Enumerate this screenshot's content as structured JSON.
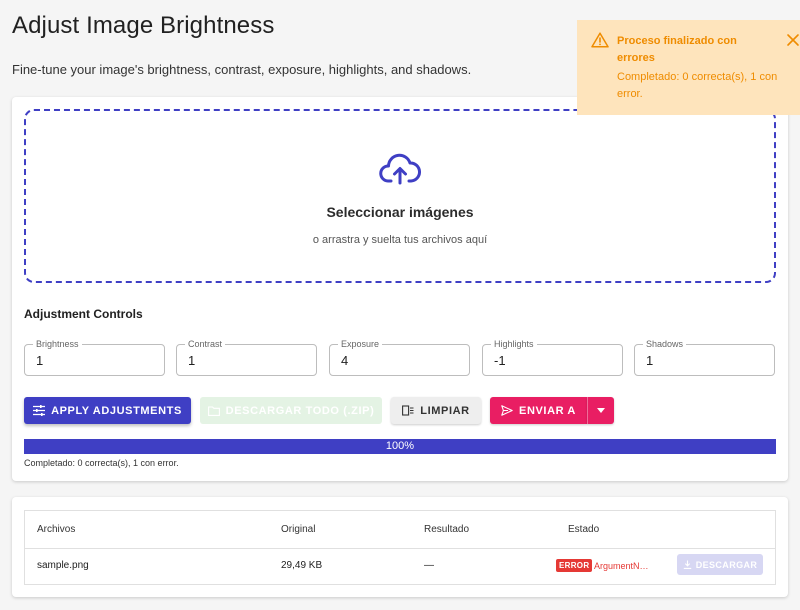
{
  "header": {
    "title": "Adjust Image Brightness",
    "description": "Fine-tune your image's brightness, contrast, exposure, highlights, and shadows."
  },
  "dropzone": {
    "icon": "cloud-upload-icon",
    "title": "Seleccionar imágenes",
    "subtitle": "o arrastra y suelta tus archivos aquí"
  },
  "controls": {
    "title": "Adjustment Controls",
    "fields": [
      {
        "label": "Brightness",
        "value": "1"
      },
      {
        "label": "Contrast",
        "value": "1"
      },
      {
        "label": "Exposure",
        "value": "4"
      },
      {
        "label": "Highlights",
        "value": "-1"
      },
      {
        "label": "Shadows",
        "value": "1"
      }
    ]
  },
  "actions": {
    "apply": "APPLY ADJUSTMENTS",
    "download_all": "DESCARGAR TODO (.ZIP)",
    "clear": "LIMPIAR",
    "send": "ENVIAR A"
  },
  "progress": {
    "percent": 100,
    "label": "100%",
    "status": "Completado: 0 correcta(s), 1 con error."
  },
  "table": {
    "headers": [
      "Archivos",
      "Original",
      "Resultado",
      "Estado"
    ],
    "rows": [
      {
        "file": "sample.png",
        "original": "29,49 KB",
        "result": "—",
        "badge": "ERROR",
        "error": "ArgumentNullException",
        "download": "DESCARGAR"
      }
    ]
  },
  "toast": {
    "title": "Proceso finalizado con errores",
    "message": "Completado: 0 correcta(s), 1 con error."
  },
  "colors": {
    "primary": "#3f3fc4",
    "accent": "#e91e63",
    "error": "#e53935",
    "warning_bg": "#fee4bc",
    "warning_text": "#ef8c00"
  }
}
